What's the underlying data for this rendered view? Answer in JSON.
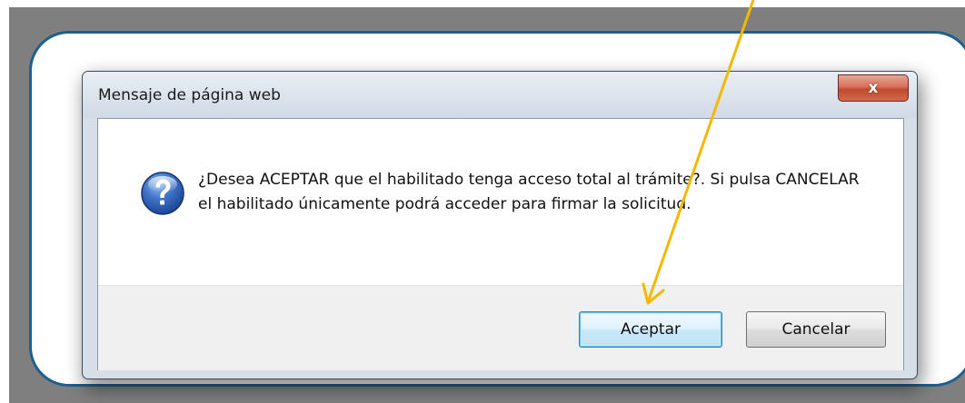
{
  "dialog": {
    "title": "Mensaje de página web",
    "close_label": "x",
    "icon": "question-icon",
    "message": "¿Desea ACEPTAR que el habilitado tenga acceso total al trámite?. Si pulsa CANCELAR el habilitado únicamente podrá acceder para firmar la solicitud.",
    "buttons": {
      "accept_label": "Aceptar",
      "cancel_label": "Cancelar"
    }
  },
  "annotation": {
    "type": "arrow",
    "color": "#f5b800",
    "points_to": "accept-button"
  },
  "colors": {
    "background": "#7f7f7f",
    "panel_border": "#1f5f8e",
    "close_button": "#c24a30",
    "default_button_focus": "#3c7fb1"
  }
}
